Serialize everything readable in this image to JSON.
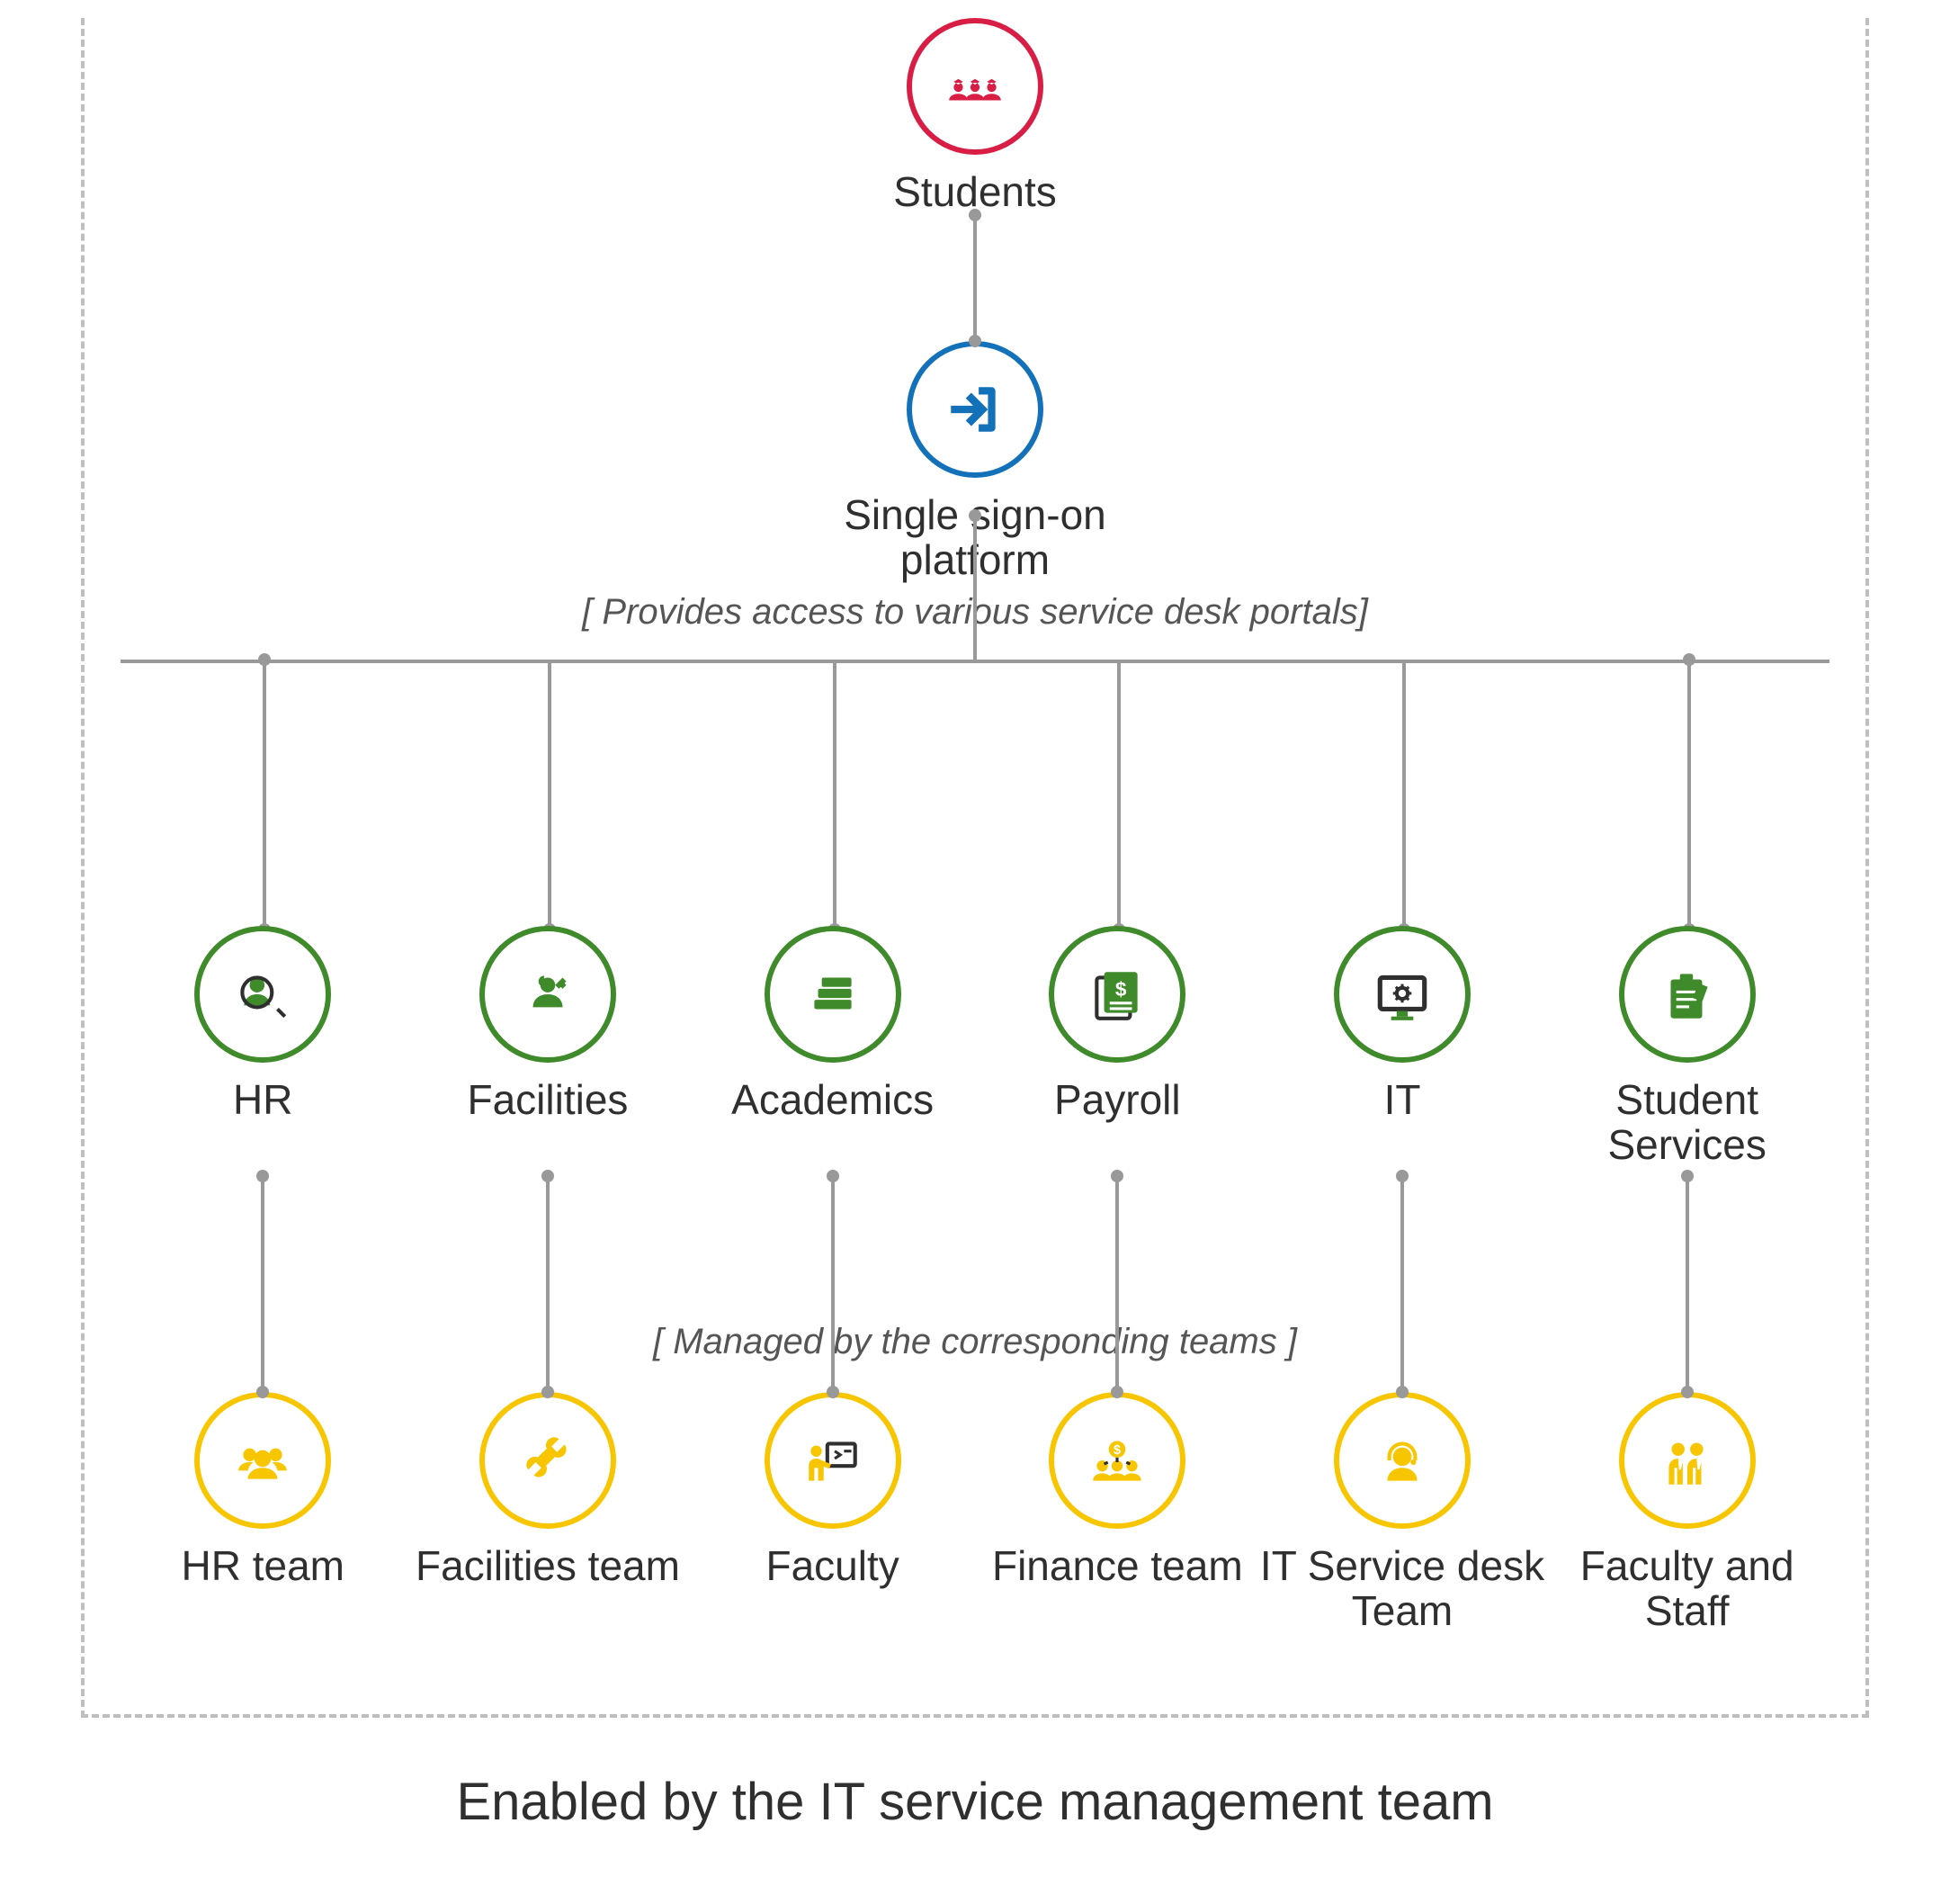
{
  "root": {
    "label": "Students",
    "icon": "students-icon",
    "color": "#d81e45"
  },
  "sso": {
    "label": "Single sign-on platform",
    "annotation": "[ Provides access to various service desk portals]",
    "icon": "login-icon",
    "color": "#1371ba"
  },
  "mid_annotation": "[ Managed by the corresponding teams ]",
  "services": [
    {
      "label": "HR",
      "icon": "hr-icon",
      "team_label": "HR team",
      "team_icon": "hr-team-icon"
    },
    {
      "label": "Facilities",
      "icon": "facilities-icon",
      "team_label": "Facilities team",
      "team_icon": "facilities-team-icon"
    },
    {
      "label": "Academics",
      "icon": "academics-icon",
      "team_label": "Faculty",
      "team_icon": "faculty-icon"
    },
    {
      "label": "Payroll",
      "icon": "payroll-icon",
      "team_label": "Finance team",
      "team_icon": "finance-team-icon"
    },
    {
      "label": "IT",
      "icon": "it-icon",
      "team_label": "IT Service desk Team",
      "team_icon": "it-team-icon"
    },
    {
      "label": "Student Services",
      "icon": "student-services-icon",
      "team_label": "Faculty and Staff",
      "team_icon": "staff-icon"
    }
  ],
  "footer": "Enabled by the IT service management team",
  "colors": {
    "service_ring": "#3f8a2a",
    "team_ring": "#f7c600",
    "connector": "#999999"
  }
}
